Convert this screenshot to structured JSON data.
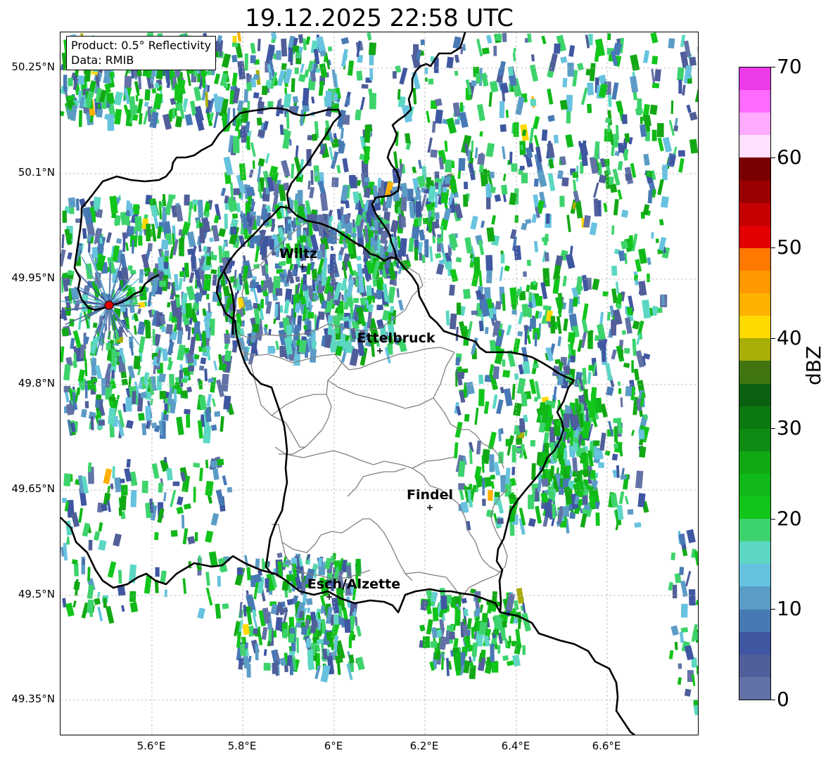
{
  "title": "19.12.2025 22:58 UTC",
  "info": {
    "product": "Product: 0.5° Reflectivity",
    "data_source": "Data: RMIB"
  },
  "axes": {
    "lon_ticks": [
      "5.6°E",
      "5.8°E",
      "6°E",
      "6.2°E",
      "6.4°E",
      "6.6°E"
    ],
    "lat_ticks": [
      "50.25°N",
      "50.1°N",
      "49.95°N",
      "49.8°N",
      "49.65°N",
      "49.5°N",
      "49.35°N"
    ]
  },
  "cities": [
    {
      "name": "Wiltz"
    },
    {
      "name": "Ettelbruck"
    },
    {
      "name": "Findel"
    },
    {
      "name": "Esch/Alzette"
    }
  ],
  "colorbar": {
    "label": "dBZ",
    "tick_labels": [
      "0",
      "10",
      "20",
      "30",
      "40",
      "50",
      "60",
      "70"
    ],
    "min": 0,
    "max": 70,
    "step": 2.5,
    "colors": [
      "#6272a6",
      "#505f99",
      "#3f56a1",
      "#4779b5",
      "#5b9cc6",
      "#67c2df",
      "#5bd7c3",
      "#3dd36c",
      "#12c51b",
      "#10b81a",
      "#12a814",
      "#0e8b13",
      "#0b7910",
      "#0a6112",
      "#417510",
      "#a8ad08",
      "#ffd900",
      "#ffb100",
      "#ff9900",
      "#ff7800",
      "#e30000",
      "#c60000",
      "#9b0000",
      "#780000",
      "#ffe1ff",
      "#ffaaff",
      "#ff6bff",
      "#ea3aea"
    ]
  },
  "radar_site_color": "#e00000"
}
